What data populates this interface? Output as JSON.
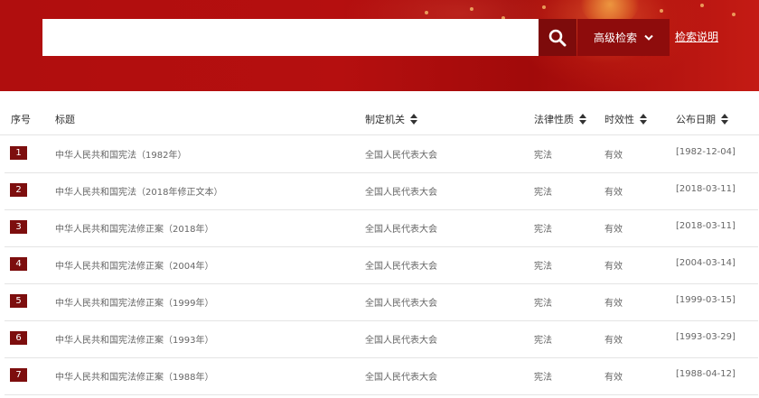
{
  "search": {
    "placeholder": "",
    "value": ""
  },
  "toolbar": {
    "advanced_label": "高级检索",
    "help_label": "检索说明"
  },
  "colors": {
    "banner": "#b00e0e",
    "button_dark": "#7d0b0b",
    "badge": "#7d0e0e"
  },
  "table": {
    "headers": {
      "index": "序号",
      "title": "标题",
      "authority": "制定机关",
      "nature": "法律性质",
      "validity": "时效性",
      "date": "公布日期"
    },
    "rows": [
      {
        "index": "1",
        "title": "中华人民共和国宪法（1982年）",
        "authority": "全国人民代表大会",
        "nature": "宪法",
        "validity": "有效",
        "date": "[1982-12-04]"
      },
      {
        "index": "2",
        "title": "中华人民共和国宪法（2018年修正文本）",
        "authority": "全国人民代表大会",
        "nature": "宪法",
        "validity": "有效",
        "date": "[2018-03-11]"
      },
      {
        "index": "3",
        "title": "中华人民共和国宪法修正案（2018年）",
        "authority": "全国人民代表大会",
        "nature": "宪法",
        "validity": "有效",
        "date": "[2018-03-11]"
      },
      {
        "index": "4",
        "title": "中华人民共和国宪法修正案（2004年）",
        "authority": "全国人民代表大会",
        "nature": "宪法",
        "validity": "有效",
        "date": "[2004-03-14]"
      },
      {
        "index": "5",
        "title": "中华人民共和国宪法修正案（1999年）",
        "authority": "全国人民代表大会",
        "nature": "宪法",
        "validity": "有效",
        "date": "[1999-03-15]"
      },
      {
        "index": "6",
        "title": "中华人民共和国宪法修正案（1993年）",
        "authority": "全国人民代表大会",
        "nature": "宪法",
        "validity": "有效",
        "date": "[1993-03-29]"
      },
      {
        "index": "7",
        "title": "中华人民共和国宪法修正案（1988年）",
        "authority": "全国人民代表大会",
        "nature": "宪法",
        "validity": "有效",
        "date": "[1988-04-12]"
      }
    ]
  }
}
